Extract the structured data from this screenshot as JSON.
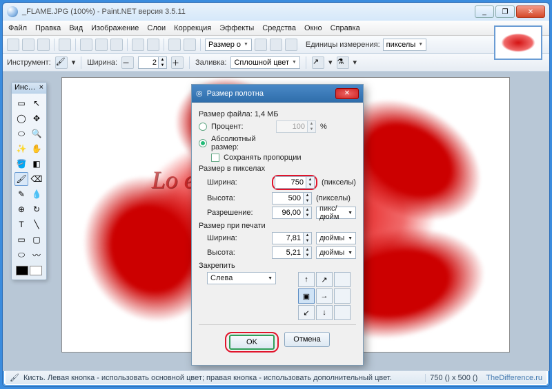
{
  "window": {
    "title": "_FLAME.JPG (100%) - Paint.NET версия 3.5.11",
    "min": "_",
    "max": "❐",
    "close": "✕"
  },
  "menu": [
    "Файл",
    "Правка",
    "Вид",
    "Изображение",
    "Слои",
    "Коррекция",
    "Эффекты",
    "Средства",
    "Окно",
    "Справка"
  ],
  "toolbar1": {
    "zoom_label": "Размер о",
    "units_label": "Единицы измерения:",
    "units_value": "пикселы"
  },
  "toolbar2": {
    "tool_label": "Инструмент:",
    "width_label": "Ширина:",
    "width_value": "2",
    "fill_label": "Заливка:",
    "fill_value": "Сплошной цвет"
  },
  "toolsPanel": {
    "title": "Инс…",
    "close": "×"
  },
  "dialog": {
    "title": "Размер полотна",
    "filesize_label": "Размер файла: 1,4 МБ",
    "percent_label": "Процент:",
    "percent_value": "100",
    "percent_unit": "%",
    "absolute_label": "Абсолютный размер:",
    "keep_aspect": "Сохранять пропорции",
    "pixels_group": "Размер в пикселах",
    "width_label": "Ширина:",
    "width_value": "750",
    "width_unit": "(пикселы)",
    "height_label": "Высота:",
    "height_value": "500",
    "height_unit": "(пикселы)",
    "resolution_label": "Разрешение:",
    "resolution_value": "96,00",
    "resolution_unit": "пикс/дюйм",
    "print_group": "Размер при печати",
    "pwidth_label": "Ширина:",
    "pwidth_value": "7,81",
    "pwidth_unit": "дюймы",
    "pheight_label": "Высота:",
    "pheight_value": "5,21",
    "pheight_unit": "дюймы",
    "anchor_label": "Закрепить",
    "anchor_value": "Слева",
    "arrows": [
      "↑",
      "↗",
      "",
      "←",
      "▣",
      "→",
      "",
      "↙",
      "↓"
    ],
    "ok": "OK",
    "cancel": "Отмена"
  },
  "status": {
    "text": "Кисть. Левая кнопка - использовать основной цвет; правая кнопка - использовать дополнительный цвет.",
    "dims": "750 () x 500 ()",
    "brand": "TheDifference.ru"
  },
  "canvas_text": "Lo            e"
}
